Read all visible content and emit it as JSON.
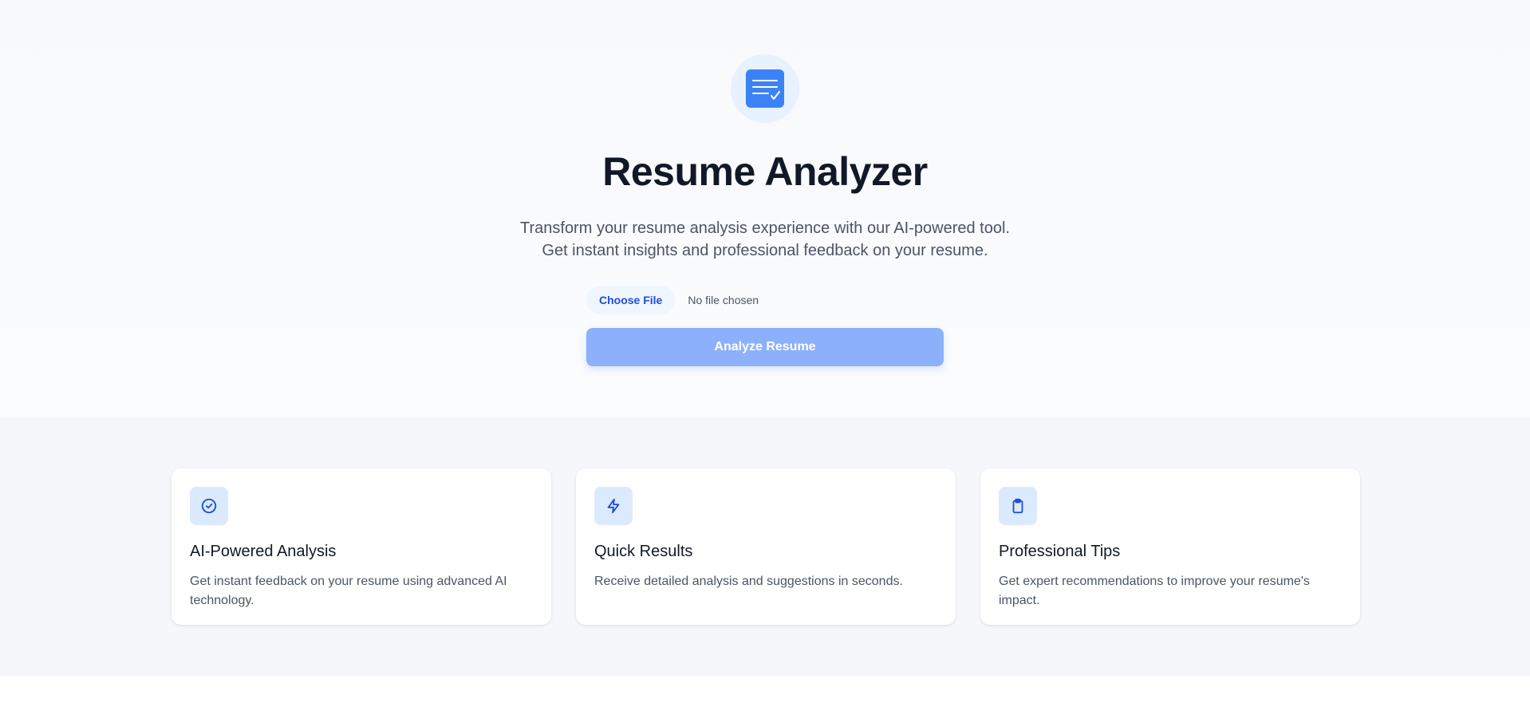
{
  "hero": {
    "logo_icon": "resume-document-check-icon",
    "title": "Resume Analyzer",
    "subtitle_line1": "Transform your resume analysis experience with our AI-powered tool.",
    "subtitle_line2": "Get instant insights and professional feedback on your resume."
  },
  "upload": {
    "choose_label": "Choose File",
    "status": "No file chosen",
    "analyze_label": "Analyze Resume"
  },
  "features": [
    {
      "icon": "check-circle-icon",
      "title": "AI-Powered Analysis",
      "text": "Get instant feedback on your resume using advanced AI technology."
    },
    {
      "icon": "lightning-bolt-icon",
      "title": "Quick Results",
      "text": "Receive detailed analysis and suggestions in seconds."
    },
    {
      "icon": "clipboard-icon",
      "title": "Professional Tips",
      "text": "Get expert recommendations to improve your resume's impact."
    }
  ],
  "colors": {
    "accent": "#3b82f6",
    "button_disabled": "#8db0fb",
    "heading": "#111827",
    "body_text": "#4b5563"
  }
}
